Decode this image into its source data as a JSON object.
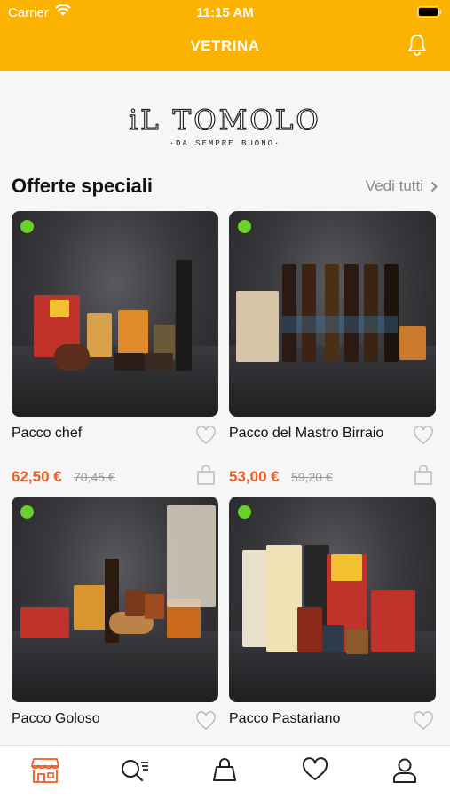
{
  "status_bar": {
    "carrier": "Carrier",
    "time": "11:15 AM"
  },
  "header": {
    "title": "VETRINA",
    "icon": "bell-icon"
  },
  "logo": {
    "main": "iL TOMOLO",
    "sub": "·DA SEMPRE BUONO·"
  },
  "section": {
    "title": "Offerte speciali",
    "see_all": "Vedi tutti"
  },
  "products": [
    {
      "name": "Pacco chef",
      "price": "62,50 €",
      "old_price": "70,45 €"
    },
    {
      "name": "Pacco del Mastro Birraio",
      "price": "53,00 €",
      "old_price": "59,20 €"
    },
    {
      "name": "Pacco Goloso"
    },
    {
      "name": "Pacco Pastariano"
    }
  ],
  "tabs": [
    {
      "icon": "store-icon",
      "active": true
    },
    {
      "icon": "search-list-icon"
    },
    {
      "icon": "bag-icon"
    },
    {
      "icon": "heart-icon"
    },
    {
      "icon": "user-icon"
    }
  ],
  "colors": {
    "accent": "#fbb200",
    "price": "#ee5d22",
    "badge": "#6ad12b",
    "tab_active": "#ee5d22"
  }
}
